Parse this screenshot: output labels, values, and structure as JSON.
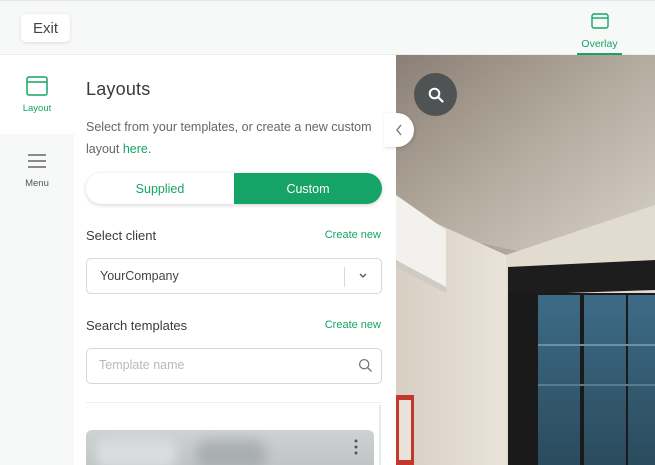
{
  "topbar": {
    "exit_label": "Exit",
    "overlay_label": "Overlay",
    "overlay_icon": "window-icon"
  },
  "rail": {
    "items": [
      {
        "label": "Layout",
        "icon": "window-icon",
        "active": true
      },
      {
        "label": "Menu",
        "icon": "hamburger-icon",
        "active": false
      }
    ]
  },
  "panel": {
    "title": "Layouts",
    "description": "Select from your templates, or create a new custom layout ",
    "description_link": "here",
    "description_end": ".",
    "toggle": {
      "options": [
        "Supplied",
        "Custom"
      ],
      "selected": "Custom"
    },
    "client": {
      "label": "Select client",
      "create_new": "Create new",
      "selected": "YourCompany"
    },
    "templates": {
      "label": "Search templates",
      "create_new": "Create new",
      "placeholder": "Template name"
    }
  },
  "colors": {
    "accent": "#16a466",
    "fab": "#505353"
  }
}
